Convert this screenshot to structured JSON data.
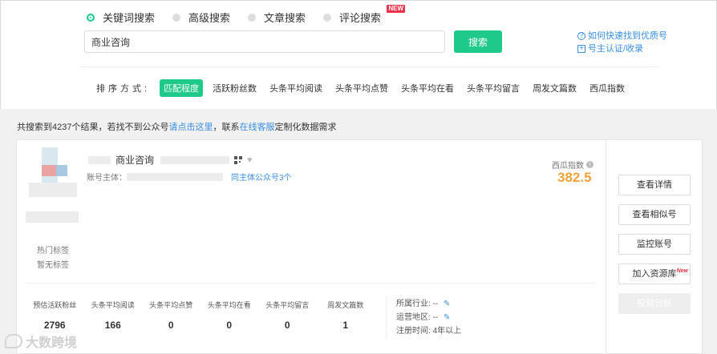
{
  "search_types": [
    {
      "label": "关键词搜索",
      "active": true
    },
    {
      "label": "高级搜索",
      "active": false
    },
    {
      "label": "文章搜索",
      "active": false
    },
    {
      "label": "评论搜索",
      "active": false,
      "badge": "NEW"
    }
  ],
  "search": {
    "value": "商业咨询",
    "button_label": "搜索"
  },
  "help_links": {
    "find_quality": "如何快速找到优质号",
    "claim": "号主认证/收录"
  },
  "sort": {
    "label": "排序方式:",
    "items": [
      "匹配程度",
      "活跃粉丝数",
      "头条平均阅读",
      "头条平均点赞",
      "头条平均在看",
      "头条平均留言",
      "周发文篇数",
      "西瓜指数"
    ],
    "active_index": 0
  },
  "results": {
    "prefix": "共搜索到4237个结果，若找不到公众号",
    "link_click": "请点击这里",
    "middle": "，联系",
    "link_service": "在线客服",
    "suffix": "定制化数据需求"
  },
  "account": {
    "name": "商业咨询",
    "subject_label": "账号主体：",
    "same_subject_link": "同主体公众号3个",
    "tags_label": "热门标签",
    "tags_value": "暂无标签",
    "score_label": "西瓜指数",
    "score_value": "382.5",
    "stats": [
      {
        "label": "预估活跃粉丝",
        "value": "2796"
      },
      {
        "label": "头条平均阅读",
        "value": "166"
      },
      {
        "label": "头条平均点赞",
        "value": "0"
      },
      {
        "label": "头条平均在看",
        "value": "0"
      },
      {
        "label": "头条平均留言",
        "value": "0"
      },
      {
        "label": "周发文篇数",
        "value": "1"
      }
    ],
    "meta": {
      "industry_label": "所属行业:",
      "industry_value": "--",
      "region_label": "运营地区:",
      "region_value": "--",
      "reg_label": "注册时间:",
      "reg_value": "4年以上"
    }
  },
  "side_buttons": {
    "details": "查看详情",
    "similar": "查看相似号",
    "monitor": "监控账号",
    "add_resource": "加入资源库",
    "add_resource_badge": "New",
    "report": "投前分析"
  },
  "watermark": "大数跨境",
  "colors": {
    "accent": "#1ec98a",
    "link": "#3a8ee6",
    "score": "#f0a33a",
    "badge": "#e8334a"
  }
}
